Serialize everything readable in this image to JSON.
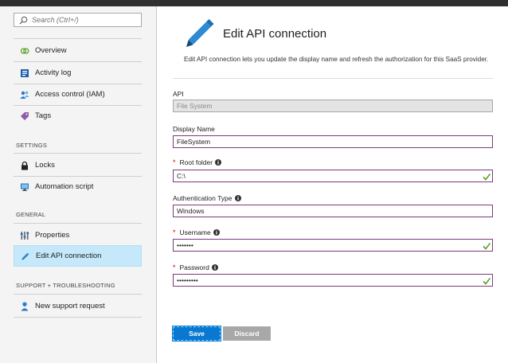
{
  "search": {
    "placeholder": "Search (Ctrl+/)"
  },
  "sidebar": {
    "items": [
      {
        "label": "Overview"
      },
      {
        "label": "Activity log"
      },
      {
        "label": "Access control (IAM)"
      },
      {
        "label": "Tags"
      }
    ],
    "settings_label": "SETTINGS",
    "settings_items": [
      {
        "label": "Locks"
      },
      {
        "label": "Automation script"
      }
    ],
    "general_label": "GENERAL",
    "general_items": [
      {
        "label": "Properties"
      },
      {
        "label": "Edit API connection"
      }
    ],
    "support_label": "SUPPORT + TROUBLESHOOTING",
    "support_items": [
      {
        "label": "New support request"
      }
    ]
  },
  "main": {
    "title": "Edit API connection",
    "description": "Edit API connection lets you update the display name and refresh the authorization for this SaaS provider.",
    "fields": {
      "api": {
        "label": "API",
        "value": "File System"
      },
      "display_name": {
        "label": "Display Name",
        "value": "FileSystem"
      },
      "root_folder": {
        "label": "Root folder",
        "value": "C:\\"
      },
      "auth_type": {
        "label": "Authentication Type",
        "value": "Windows"
      },
      "username": {
        "label": "Username",
        "value": "•••••••"
      },
      "password": {
        "label": "Password",
        "value": "•••••••••"
      }
    },
    "required_marker": "*",
    "save_label": "Save",
    "discard_label": "Discard"
  },
  "colors": {
    "accent": "#0a78d1",
    "active_item": "#c5e8fa",
    "field_border": "#7a3a79",
    "check": "#5aa02c",
    "required": "#d10000"
  }
}
